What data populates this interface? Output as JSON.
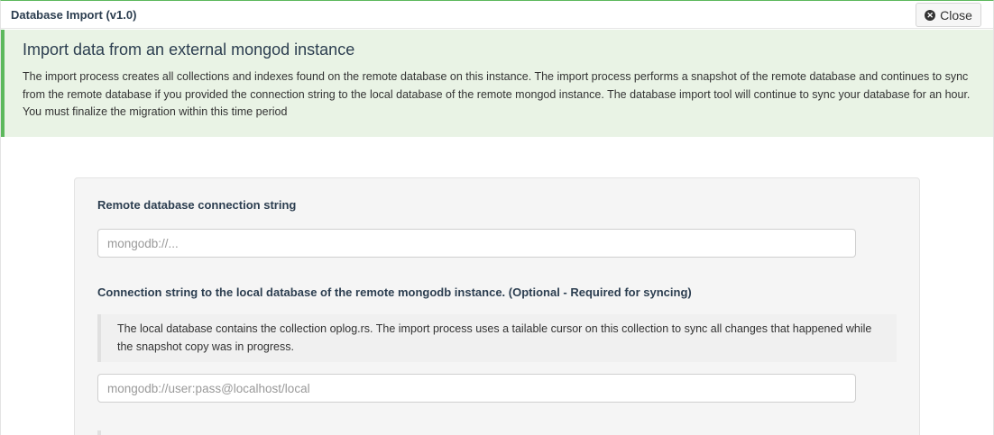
{
  "window": {
    "title": "Database Import (v1.0)",
    "close_label": "Close"
  },
  "banner": {
    "title": "Import data from an external mongod instance",
    "text": "The import process creates all collections and indexes found on the remote database on this instance. The import process performs a snapshot of the remote database and continues to sync from the remote database if you provided the connection string to the local database of the remote mongod instance. The database import tool will continue to sync your database for an hour. You must finalize the migration within this time period"
  },
  "form": {
    "remote": {
      "label": "Remote database connection string",
      "placeholder": "mongodb://...",
      "value": ""
    },
    "local": {
      "label": "Connection string to the local database of the remote mongodb instance. (Optional - Required for syncing)",
      "note": "The local database contains the collection oplog.rs. The import process uses a tailable cursor on this collection to sync all changes that happened while the snapshot copy was in progress.",
      "placeholder": "mongodb://user:pass@localhost/local",
      "value": ""
    }
  },
  "colors": {
    "accent": "#5cb85c",
    "banner_bg": "#e9f3e5",
    "heading": "#2c3e50"
  },
  "icons": {
    "close": "times-circle-icon"
  }
}
